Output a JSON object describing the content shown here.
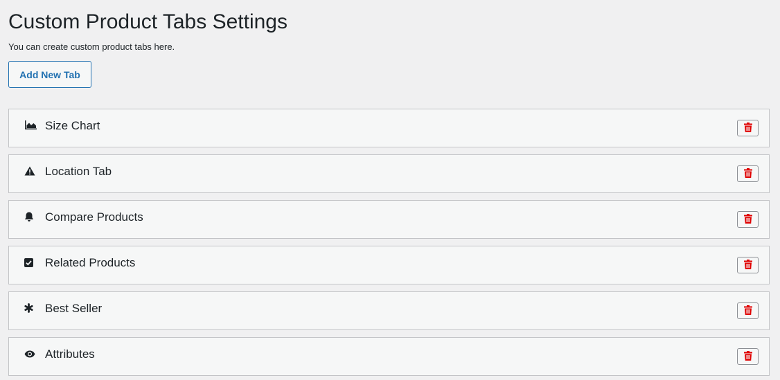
{
  "header": {
    "title": "Custom Product Tabs Settings",
    "description": "You can create custom product tabs here."
  },
  "actions": {
    "add_label": "Add New Tab"
  },
  "colors": {
    "accent": "#2271b1",
    "delete": "#e00000",
    "row_bg": "#f6f7f7",
    "page_bg": "#f0f0f1"
  },
  "tabs": [
    {
      "label": "Size Chart",
      "icon": "area-chart-icon"
    },
    {
      "label": "Location Tab",
      "icon": "warning-icon"
    },
    {
      "label": "Compare Products",
      "icon": "bell-icon"
    },
    {
      "label": "Related Products",
      "icon": "checkbox-icon"
    },
    {
      "label": "Best Seller",
      "icon": "asterisk-icon"
    },
    {
      "label": "Attributes",
      "icon": "eye-icon"
    }
  ]
}
